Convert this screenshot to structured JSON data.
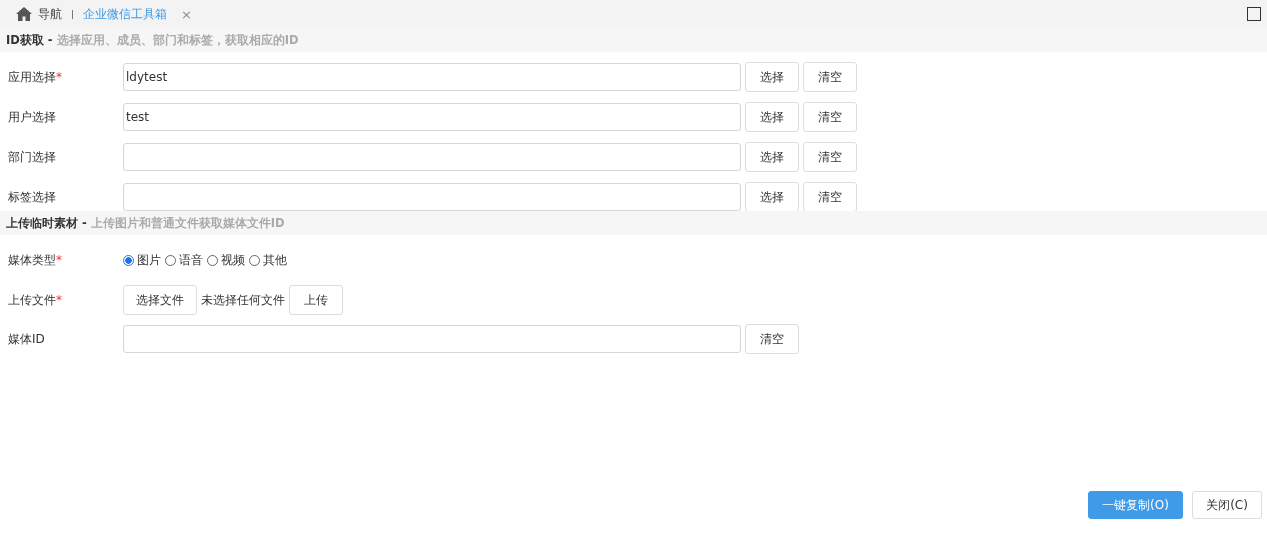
{
  "tabs": [
    {
      "kind": "home",
      "label": "导航",
      "selected": false
    },
    {
      "kind": "page",
      "label": "企业微信工具箱",
      "selected": true,
      "close": "×"
    }
  ],
  "sections": [
    {
      "title": "ID获取",
      "dash": "-",
      "subtitle": "选择应用、成员、部门和标签，获取相应的ID",
      "fields": [
        {
          "kind": "text",
          "label": "应用选择",
          "required_mark": "*",
          "value": "ldytest",
          "buttons": [
            "选择",
            "清空"
          ]
        },
        {
          "kind": "text",
          "label": "用户选择",
          "value": "test",
          "buttons": [
            "选择",
            "清空"
          ]
        },
        {
          "kind": "text",
          "label": "部门选择",
          "buttons": [
            "选择",
            "清空"
          ]
        },
        {
          "kind": "text",
          "label": "标签选择",
          "buttons": [
            "选择",
            "清空"
          ]
        }
      ]
    },
    {
      "title": "上传临时素材",
      "dash": "-",
      "subtitle": "上传图片和普通文件获取媒体文件ID",
      "fields": [
        {
          "kind": "radio",
          "label": "媒体类型",
          "required_mark": "*",
          "options": [
            {
              "label": "图片",
              "selected": true
            },
            {
              "label": "语音",
              "selected": false
            },
            {
              "label": "视频",
              "selected": false
            },
            {
              "label": "其他",
              "selected": false
            }
          ]
        },
        {
          "kind": "file",
          "label": "上传文件",
          "required_mark": "*",
          "choose": "选择文件",
          "status": "未选择任何文件",
          "buttons": [
            "上传"
          ]
        },
        {
          "kind": "text",
          "label": "媒体ID",
          "buttons": [
            "清空"
          ]
        }
      ]
    }
  ],
  "footer": [
    {
      "kind": "primary",
      "label": "一键复制(O)"
    },
    {
      "kind": "default",
      "label": "关闭(C)"
    }
  ]
}
